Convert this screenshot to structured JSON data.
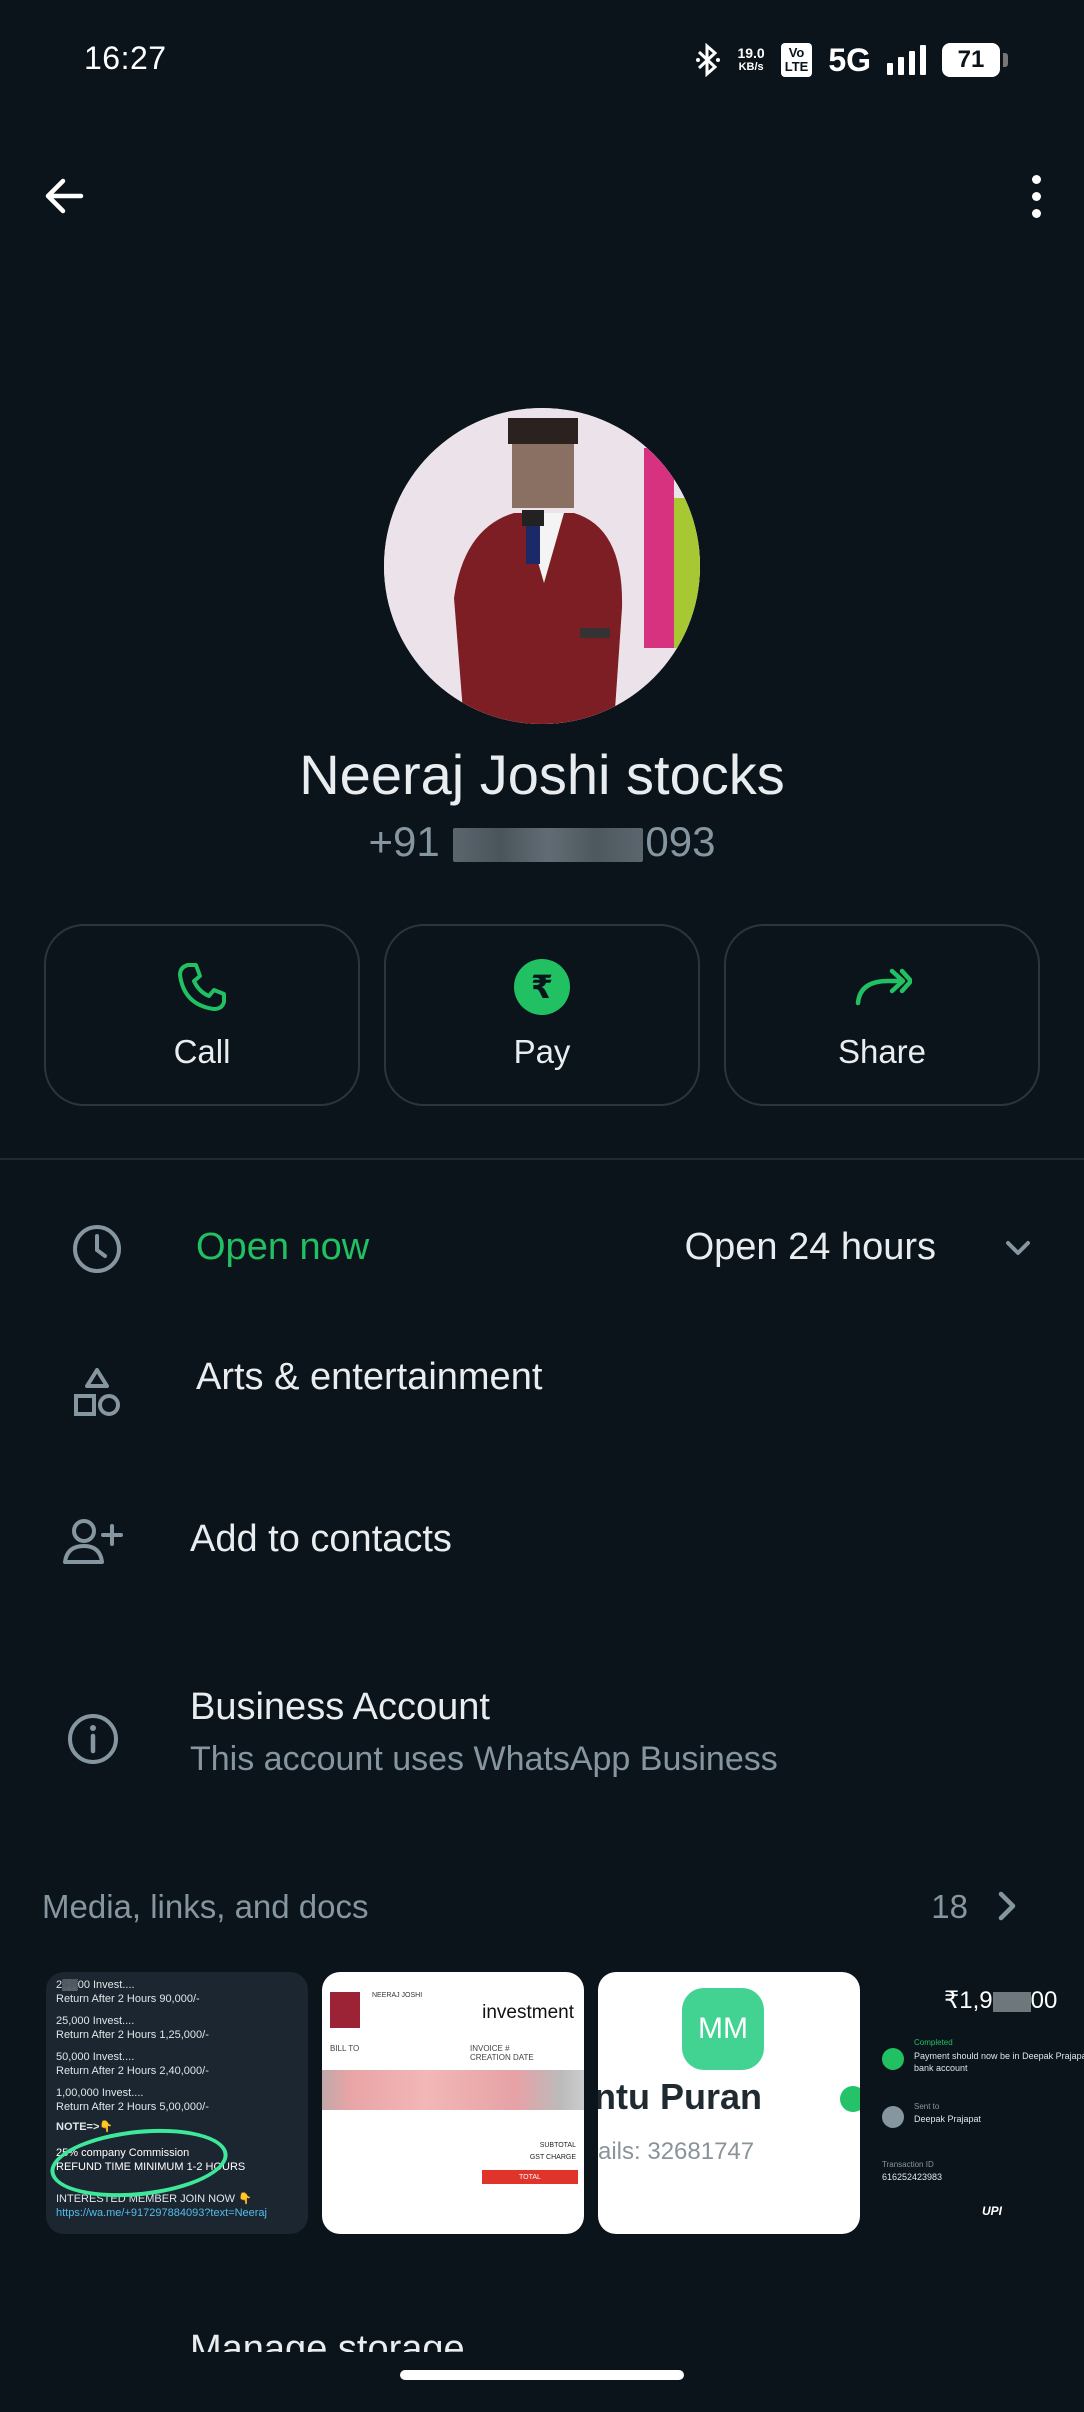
{
  "status_bar": {
    "time": "16:27",
    "net_speed_value": "19.0",
    "net_speed_unit": "KB/s",
    "volte_top": "Vo",
    "volte_bottom": "LTE",
    "network": "5G",
    "battery": "71"
  },
  "profile": {
    "name": "Neeraj Joshi stocks",
    "phone_prefix": "+91",
    "phone_suffix": "093"
  },
  "actions": [
    {
      "label": "Call",
      "icon": "phone-icon"
    },
    {
      "label": "Pay",
      "icon": "rupee-icon",
      "symbol": "₹"
    },
    {
      "label": "Share",
      "icon": "share-icon"
    }
  ],
  "hours": {
    "status": "Open now",
    "detail": "Open 24 hours"
  },
  "category": {
    "label": "Arts & entertainment"
  },
  "add_contact": {
    "label": "Add to contacts"
  },
  "business": {
    "title": "Business Account",
    "subtitle": "This account uses WhatsApp Business"
  },
  "media": {
    "header": "Media, links, and docs",
    "count": "18",
    "thumb1": {
      "l1": "2▒▒00 Invest....",
      "l2": "Return After 2 Hours 90,000/-",
      "l3": "25,000 Invest....",
      "l4": "Return After 2 Hours 1,25,000/-",
      "l5": "50,000 Invest....",
      "l6": "Return After 2 Hours 2,40,000/-",
      "l7": "1,00,000 Invest....",
      "l8": "Return After 2 Hours 5,00,000/-",
      "note": "NOTE=>👇",
      "c1": "25% company Commission",
      "c2": "REFUND TIME MINIMUM 1-2 HOURS",
      "join": "INTERESTED MEMBER JOIN NOW 👇",
      "link": "https://wa.me/+917297884093?text=Neeraj"
    },
    "thumb2": {
      "title": "investment",
      "small_name": "NEERAJ JOSHI",
      "bill_to": "BILL TO",
      "invoice_no": "INVOICE #",
      "creation_date": "CREATION DATE",
      "subtotal": "SUBTOTAL",
      "gst": "GST CHARGE",
      "total": "TOTAL"
    },
    "thumb3": {
      "initials": "MM",
      "name": "ntu Puran",
      "details": "ails: 32681747"
    },
    "thumb4": {
      "amount_prefix": "₹1,9",
      "amount_suffix": "00",
      "completed": "Completed",
      "payment_msg": "Payment should now be in Deepak Prajapat bank account",
      "sent_to": "Sent to",
      "sent_name": "Deepak Prajapat",
      "txn_label": "Transaction ID",
      "txn_id": "616252423983",
      "upi": "UPI"
    }
  },
  "manage_storage": "Manage storage",
  "colors": {
    "background": "#0b141a",
    "accent_green": "#21c063",
    "text_primary": "#e9edef",
    "text_secondary": "#8696a0",
    "button_border": "#2a363d"
  }
}
